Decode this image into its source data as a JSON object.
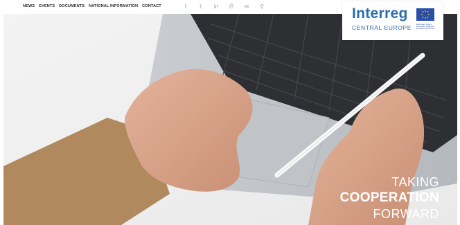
{
  "nav": {
    "items": [
      "NEWS",
      "EVENTS",
      "DOCUMENTS",
      "NATIONAL INFORMATION",
      "CONTACT"
    ]
  },
  "social": {
    "icons": [
      "facebook-icon",
      "twitter-icon",
      "linkedin-icon",
      "print-icon",
      "mail-icon",
      "search-icon"
    ],
    "glyphs": [
      "f",
      "𝕥",
      "in",
      "⎙",
      "✉",
      "⚲"
    ]
  },
  "logo": {
    "word": "Interreg",
    "sub": "CENTRAL EUROPE",
    "eu_small": "European Union European Regional Development Fund"
  },
  "hero": {
    "line1": "TAKING",
    "line2": "COOPERATION",
    "line3": "FORWARD"
  },
  "colors": {
    "brand_blue": "#2b6cb0",
    "eu_blue": "#2a4fa8",
    "eu_gold": "#ffd21f",
    "nav_text": "#2f2f2f",
    "icon_gray": "#9aa0a6"
  }
}
